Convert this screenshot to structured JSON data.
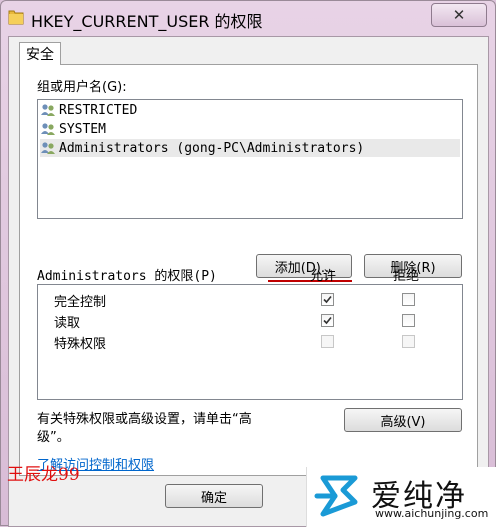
{
  "window": {
    "title": "HKEY_CURRENT_USER 的权限"
  },
  "tabs": [
    {
      "label": "安全"
    }
  ],
  "users_section": {
    "label": "组或用户名(G):",
    "items": [
      {
        "name": "RESTRICTED"
      },
      {
        "name": "SYSTEM"
      },
      {
        "name": "Administrators (gong-PC\\Administrators)"
      }
    ]
  },
  "buttons": {
    "add": "添加(D)...",
    "remove": "删除(R)",
    "advanced": "高级(V)",
    "ok": "确定"
  },
  "permissions": {
    "label": "Administrators 的权限(P)",
    "allow_header": "允许",
    "deny_header": "拒绝",
    "rows": [
      {
        "name": "完全控制",
        "allow": true,
        "deny": false,
        "enabled": true
      },
      {
        "name": "读取",
        "allow": true,
        "deny": false,
        "enabled": true
      },
      {
        "name": "特殊权限",
        "allow": false,
        "deny": false,
        "enabled": false
      }
    ]
  },
  "advanced_text_line1": "有关特殊权限或高级设置，请单击“高",
  "advanced_text_line2": "级”。",
  "help_link": "了解访问控制和权限",
  "watermark_name": "王辰龙99",
  "brand": {
    "name": "爱纯净",
    "url": "www.aichunjing.com"
  },
  "colors": {
    "accent_red": "#c00000",
    "link_blue": "#0066cc"
  }
}
